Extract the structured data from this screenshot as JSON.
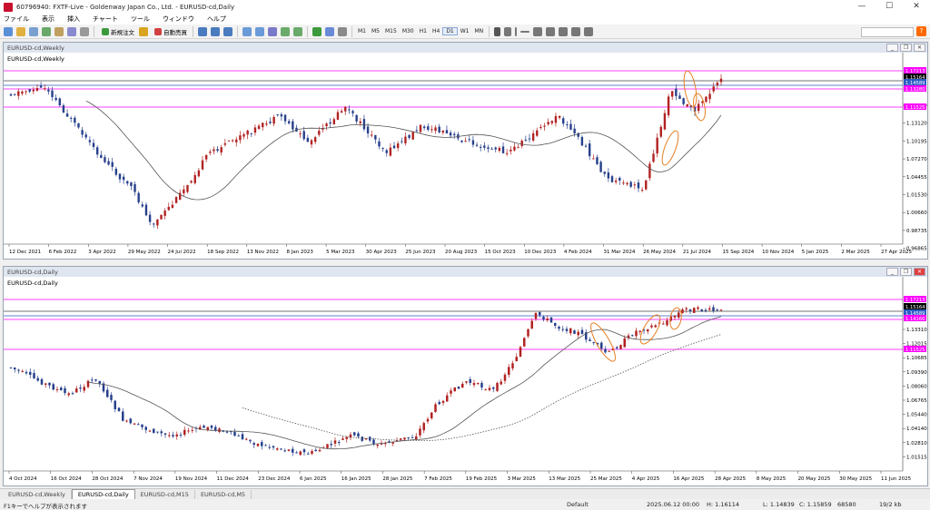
{
  "window": {
    "title": "60796940: FXTF-Live - Goldenway Japan Co., Ltd. - EURUSD-cd,Daily",
    "min": "—",
    "max": "☐",
    "close": "✕"
  },
  "menu": [
    "ファイル",
    "表示",
    "挿入",
    "チャート",
    "ツール",
    "ウィンドウ",
    "ヘルプ"
  ],
  "toolbar": {
    "new_order": "新規注文",
    "auto_trade": "自動売買",
    "timeframes": [
      "M1",
      "M5",
      "M15",
      "M30",
      "H1",
      "H4",
      "D1",
      "W1",
      "MN"
    ],
    "active_tf": "D1",
    "help_icon": "?"
  },
  "weekly": {
    "window_title": "EURUSD-cd,Weekly",
    "symbol_label": "EURUSD-cd,Weekly",
    "price_labels": [
      "1.17213",
      "1.15164",
      "1.14589",
      "1.13280",
      "1.11525"
    ],
    "axis_labels": [
      "1.13120",
      "1.10195",
      "1.07270",
      "1.04455",
      "1.01530",
      "0.98660",
      "0.95790",
      "0.92960",
      "0.95075"
    ],
    "axis_labels_full": [
      "1.16040",
      "1.13120",
      "1.10195",
      "1.07270",
      "1.04455",
      "1.01530",
      "1.00660",
      "0.98735",
      "0.96865",
      "0.94995"
    ],
    "dates": [
      "12 Dec 2021",
      "6 Feb 2022",
      "3 Apr 2022",
      "29 May 2022",
      "24 Jul 2022",
      "18 Sep 2022",
      "13 Nov 2022",
      "8 Jan 2023",
      "5 Mar 2023",
      "30 Apr 2023",
      "25 Jun 2023",
      "20 Aug 2023",
      "15 Oct 2023",
      "10 Dec 2023",
      "4 Feb 2024",
      "31 Mar 2024",
      "26 May 2024",
      "21 Jul 2024",
      "15 Sep 2024",
      "10 Nov 2024",
      "5 Jan 2025",
      "2 Mar 2025",
      "27 Apr 2025"
    ]
  },
  "daily": {
    "window_title": "EURUSD-cd,Daily",
    "symbol_label": "EURUSD-cd,Daily",
    "price_labels": [
      "1.17213",
      "1.15164",
      "1.14589",
      "1.14166",
      "1.11525"
    ],
    "axis_labels": [
      "1.13310",
      "1.12015",
      "1.10685",
      "1.09390",
      "1.08060",
      "1.06765",
      "1.05440",
      "1.04140",
      "1.02810",
      "1.01515"
    ],
    "dates": [
      "4 Oct 2024",
      "16 Oct 2024",
      "28 Oct 2024",
      "7 Nov 2024",
      "19 Nov 2024",
      "11 Dec 2024",
      "23 Dec 2024",
      "6 Jan 2025",
      "16 Jan 2025",
      "28 Jan 2025",
      "7 Feb 2025",
      "19 Feb 2025",
      "3 Mar 2025",
      "13 Mar 2025",
      "25 Mar 2025",
      "4 Apr 2025",
      "16 Apr 2025",
      "28 Apr 2025",
      "8 May 2025",
      "20 May 2025",
      "30 May 2025",
      "11 Jun 2025"
    ]
  },
  "tabs": [
    "EURUSD-cd,Weekly",
    "EURUSD-cd,Daily",
    "EURUSD-cd,M15",
    "EURUSD-cd,M5"
  ],
  "active_tab": "EURUSD-cd,Daily",
  "status": {
    "help": "F1キーでヘルプが表示されます",
    "profile": "Default",
    "datetime": "2025.06.12 00:00",
    "h": "H: 1.16114",
    "l": "L: 1.14839",
    "c": "C: 1.15859",
    "bars": "68580",
    "conn": "19/2 kb"
  },
  "colors": {
    "bull": "#b22222",
    "bear": "#27408b",
    "hline": "#ff00ff",
    "ma": "#555555",
    "ellipse": "#e67e22"
  }
}
